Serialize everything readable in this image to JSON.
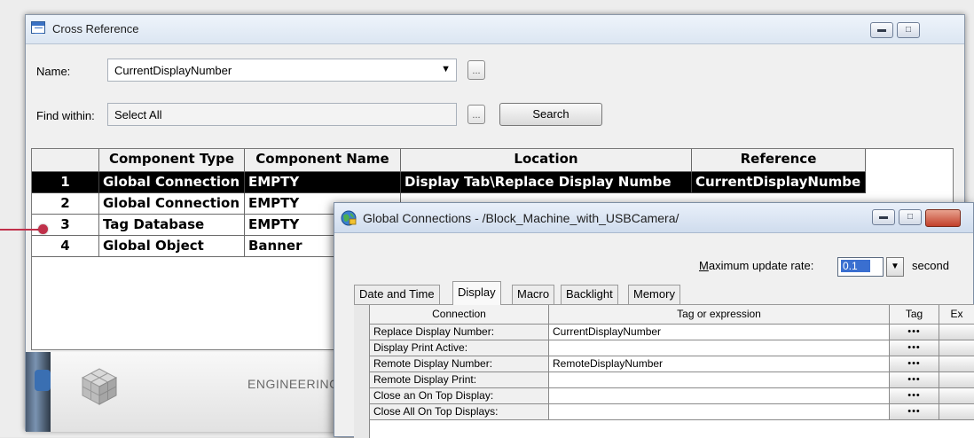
{
  "cross_reference": {
    "title": "Cross Reference",
    "name_label": "Name:",
    "name_value": "CurrentDisplayNumber",
    "find_within_label": "Find within:",
    "find_within_value": "Select All",
    "ellipsis": "...",
    "search_label": "Search",
    "columns": [
      "",
      "Component Type",
      "Component Name",
      "Location",
      "Reference"
    ],
    "rows": [
      {
        "num": "1",
        "type": "Global Connection",
        "name": "EMPTY",
        "location": "Display Tab\\Replace Display Numbe",
        "reference": "CurrentDisplayNumbe",
        "selected": true
      },
      {
        "num": "2",
        "type": "Global Connection",
        "name": "EMPTY",
        "location": "",
        "reference": ""
      },
      {
        "num": "3",
        "type": "Tag Database",
        "name": "EMPTY",
        "location": "",
        "reference": ""
      },
      {
        "num": "4",
        "type": "Global Object",
        "name": "Banner",
        "location": "",
        "reference": ""
      }
    ],
    "footer_text": "ENGINEERING"
  },
  "global_connections": {
    "title": "Global Connections - /Block_Machine_with_USBCamera/",
    "rate_label_mnemonic": "M",
    "rate_label_rest": "aximum update rate:",
    "rate_value": "0.1",
    "rate_unit": "second",
    "tabs": [
      "Date and Time",
      "Display",
      "Macro",
      "Backlight",
      "Memory"
    ],
    "active_tab": "Display",
    "columns": [
      "Connection",
      "Tag or expression",
      "Tag",
      "Ex"
    ],
    "tag_button": "•••",
    "rows": [
      {
        "connection": "Replace Display Number:",
        "tag": "CurrentDisplayNumber"
      },
      {
        "connection": "Display Print Active:",
        "tag": ""
      },
      {
        "connection": "Remote Display Number:",
        "tag": "RemoteDisplayNumber"
      },
      {
        "connection": "Remote Display Print:",
        "tag": ""
      },
      {
        "connection": "Close an On Top Display:",
        "tag": ""
      },
      {
        "connection": "Close All On Top Displays:",
        "tag": ""
      }
    ]
  },
  "colors": {
    "selection": "#000000",
    "callout": "#c0304a",
    "titlebar": "#dce6f2"
  },
  "icons": [
    "cross-reference-app-icon",
    "globe-connections-icon",
    "minimize-icon",
    "maximize-icon",
    "close-icon",
    "dropdown-arrow-icon",
    "cube-logo-icon"
  ]
}
